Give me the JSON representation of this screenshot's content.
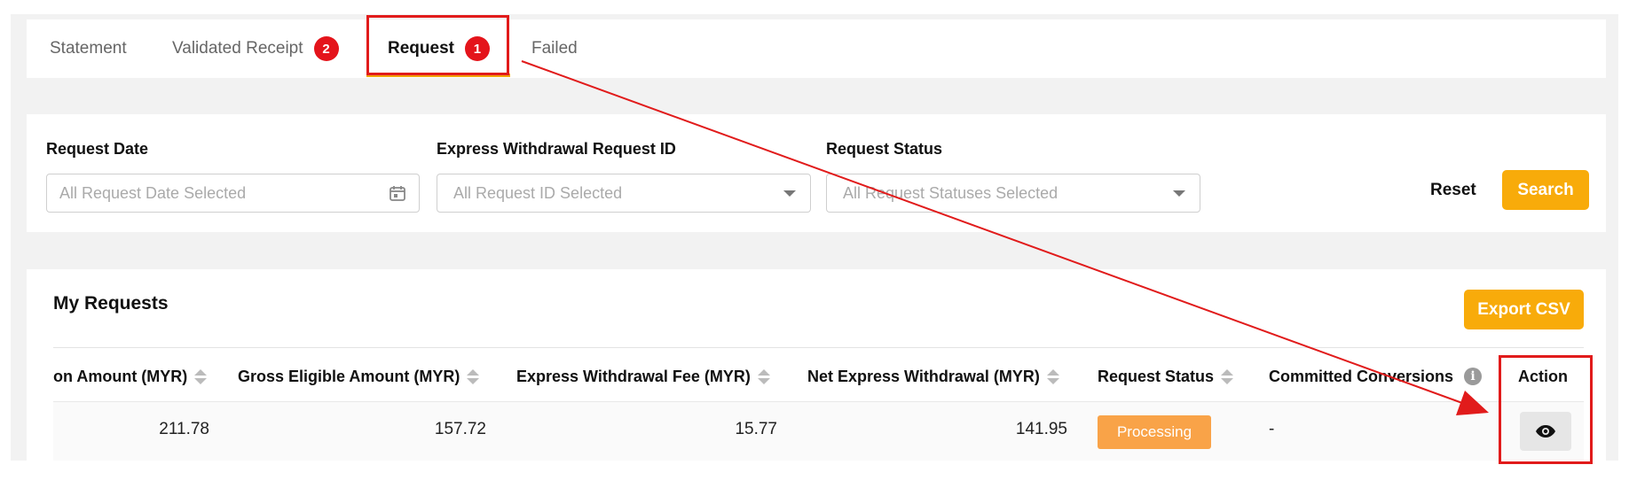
{
  "tabs": [
    {
      "label": "Statement"
    },
    {
      "label": "Validated Receipt",
      "badge": "2"
    },
    {
      "label": "Request",
      "badge": "1",
      "active": true
    },
    {
      "label": "Failed"
    }
  ],
  "filters": {
    "request_date": {
      "label": "Request Date",
      "placeholder": "All Request Date Selected",
      "icon": "calendar-icon"
    },
    "request_id": {
      "label": "Express Withdrawal Request ID",
      "placeholder": "All Request ID Selected"
    },
    "request_status": {
      "label": "Request Status",
      "placeholder": "All Request Statuses Selected"
    },
    "reset_label": "Reset",
    "search_label": "Search"
  },
  "requests": {
    "title": "My Requests",
    "export_label": "Export CSV",
    "columns": [
      "on Amount (MYR)",
      "Gross Eligible Amount (MYR)",
      "Express Withdrawal Fee (MYR)",
      "Net Express Withdrawal (MYR)",
      "Request Status",
      "Committed Conversions",
      "Action"
    ],
    "rows": [
      {
        "conversion_amount": "211.78",
        "gross_eligible": "157.72",
        "fee": "15.77",
        "net": "141.95",
        "status": "Processing",
        "committed": "-",
        "action_icon": "eye-icon"
      }
    ]
  },
  "colors": {
    "accent": "#f8ab0a",
    "badge": "#e4141b",
    "status_processing": "#f9a348",
    "annotation": "#e11b1b"
  }
}
